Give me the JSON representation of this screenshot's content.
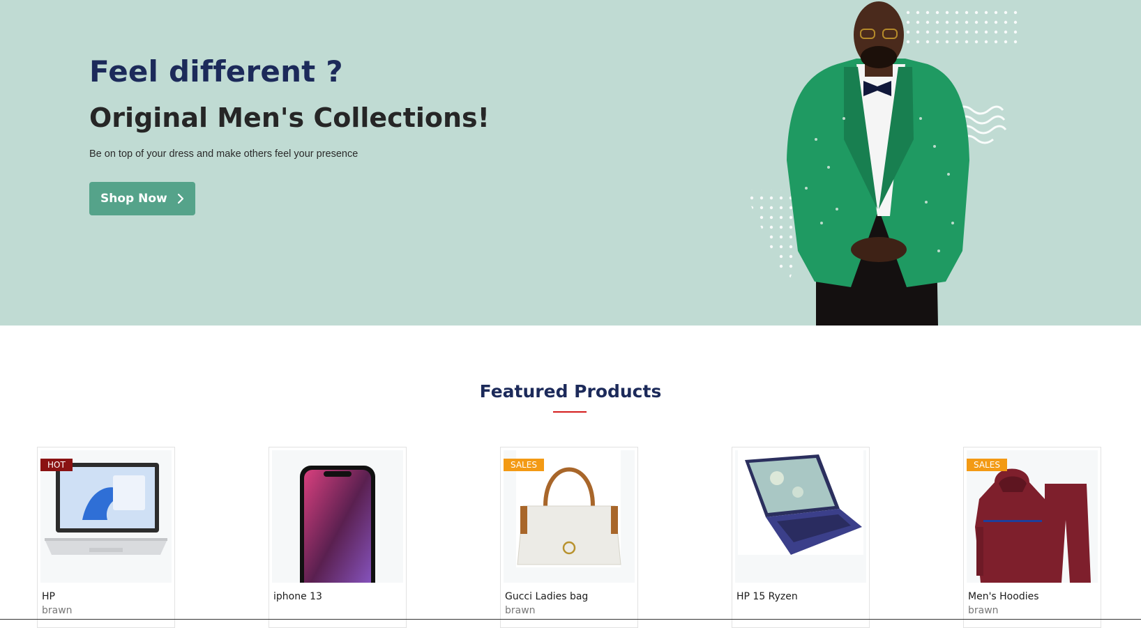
{
  "hero": {
    "headline": "Feel different ?",
    "subheadline": "Original Men's Collections!",
    "tagline": "Be on top of your dress and make others feel your presence",
    "cta_label": "Shop Now",
    "cta_icon": "chevron-right-icon",
    "background_color": "#c0dbd3",
    "accent_color": "#55a38a"
  },
  "featured": {
    "title": "Featured Products",
    "underline_color": "#d41c1c"
  },
  "products": [
    {
      "name": "HP",
      "brand": "brawn",
      "badge": "HOT"
    },
    {
      "name": "iphone 13",
      "brand": "",
      "badge": ""
    },
    {
      "name": "Gucci Ladies bag",
      "brand": "brawn",
      "badge": "SALES"
    },
    {
      "name": "HP 15 Ryzen",
      "brand": "",
      "badge": ""
    },
    {
      "name": "Men's Hoodies",
      "brand": "brawn",
      "badge": "SALES"
    }
  ]
}
